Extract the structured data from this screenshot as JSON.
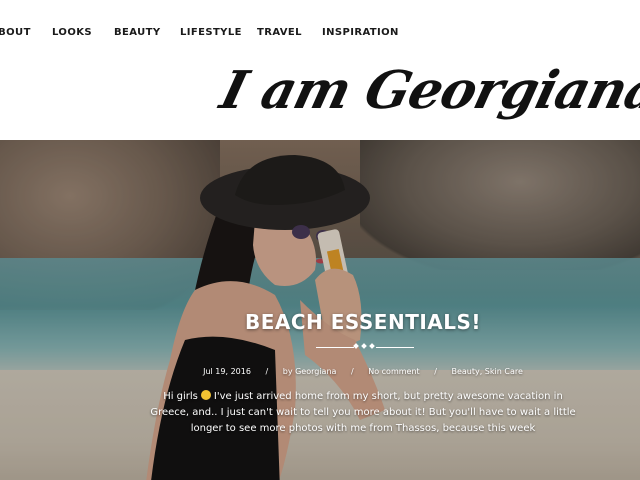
{
  "nav": {
    "items": [
      {
        "label": "ABOUT"
      },
      {
        "label": "LOOKS"
      },
      {
        "label": "BEAUTY"
      },
      {
        "label": "LIFESTYLE"
      },
      {
        "label": "TRAVEL"
      },
      {
        "label": "INSPIRATION"
      }
    ]
  },
  "logo": {
    "text": "I am Georgiana"
  },
  "post": {
    "title": "BEACH ESSENTIALS!",
    "date": "Jul 19, 2016",
    "author": "by Georgiana",
    "comments": "No comment",
    "categories": "Beauty, Skin Care",
    "separator": "/",
    "excerpt_greeting": "Hi girls",
    "emoji_icon": "smiley-face-icon",
    "excerpt_body": "I've just arrived home from my short, but pretty awesome vacation in Greece, and.. I just can't wait to tell you more about it! But you'll have to wait a little longer to see more photos with me from Thassos, because this week"
  },
  "colors": {
    "nav_text": "#1a1a1a",
    "hero_text": "#ffffff",
    "emoji": "#f1c232"
  }
}
